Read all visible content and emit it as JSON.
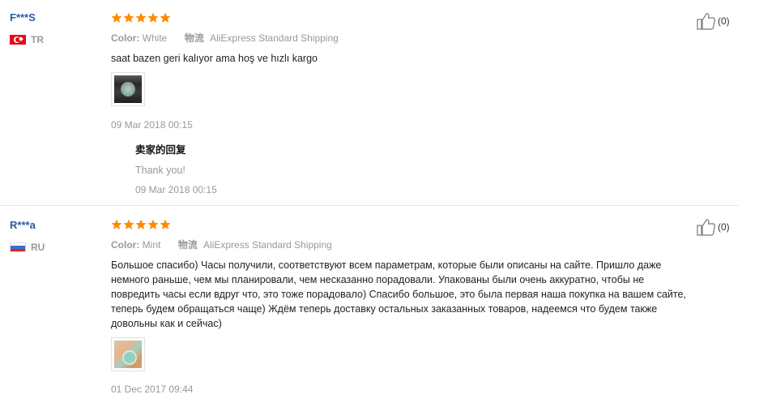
{
  "reviews": [
    {
      "user": "F***S",
      "country": "TR",
      "rating": 5,
      "color_label": "Color:",
      "color_value": "White",
      "shipping_label": "物流",
      "shipping_value": "AliExpress Standard Shipping",
      "content": "saat bazen geri kalıyor ama hoş ve hızlı kargo",
      "date": "09 Mar 2018 00:15",
      "helpful_count": "(0)",
      "reply": {
        "title": "卖家的回复",
        "text": "Thank you!",
        "date": "09 Mar 2018 00:15"
      }
    },
    {
      "user": "R***a",
      "country": "RU",
      "rating": 5,
      "color_label": "Color:",
      "color_value": "Mint",
      "shipping_label": "物流",
      "shipping_value": "AliExpress Standard Shipping",
      "content_lines": [
        "Большое спасибо) Часы получили, соответствуют всем параметрам, которые были описаны на сайте. Пришло даже",
        "немного раньше, чем мы планировали, чем несказанно порадовали. Упакованы были очень аккуратно, чтобы не",
        "повредить часы если вдруг что, это тоже порадовало) Спасибо большое, это была первая наша покупка на вашем сайте,",
        "теперь будем обращаться чаще) Ждём теперь доставку остальных заказанных товаров, надеемся что будем также",
        "довольны как и сейчас)"
      ],
      "date": "01 Dec 2017 09:44",
      "helpful_count": "(0)"
    }
  ],
  "colors": {
    "username": "#2a5aa8",
    "star": "#ff8a00",
    "muted": "#999999"
  },
  "icons": {
    "star": "star-icon",
    "helpful": "thumb-up-icon",
    "flag_tr": "turkey-flag-icon",
    "flag_ru": "russia-flag-icon"
  }
}
